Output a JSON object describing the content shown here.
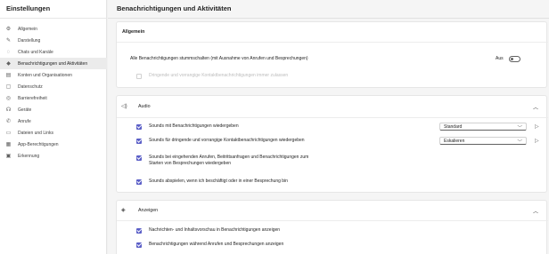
{
  "sidebar": {
    "title": "Einstellungen",
    "items": [
      {
        "label": "Allgemein",
        "icon": "gear-icon",
        "glyph": "⚙"
      },
      {
        "label": "Darstellung",
        "icon": "brush-icon",
        "glyph": "✎"
      },
      {
        "label": "Chats und Kanäle",
        "icon": "chat-icon",
        "glyph": "◌"
      },
      {
        "label": "Benachrichtigungen und Aktivitäten",
        "icon": "bell-icon",
        "glyph": "◆"
      },
      {
        "label": "Konten und Organisationen",
        "icon": "building-icon",
        "glyph": "▤"
      },
      {
        "label": "Datenschutz",
        "icon": "lock-icon",
        "glyph": "▢"
      },
      {
        "label": "Barrierefreiheit",
        "icon": "accessibility-icon",
        "glyph": "◎"
      },
      {
        "label": "Geräte",
        "icon": "headset-icon",
        "glyph": "☊"
      },
      {
        "label": "Anrufe",
        "icon": "phone-icon",
        "glyph": "✆"
      },
      {
        "label": "Dateien und Links",
        "icon": "file-icon",
        "glyph": "▭"
      },
      {
        "label": "App-Berechtigungen",
        "icon": "apps-icon",
        "glyph": "▦"
      },
      {
        "label": "Erkennung",
        "icon": "recognition-icon",
        "glyph": "▣"
      }
    ],
    "active_index": 3
  },
  "page": {
    "title": "Benachrichtigungen und Aktivitäten"
  },
  "allgemein": {
    "heading": "Allgemein",
    "mute_label": "Alle Benachrichtigungen stummschalten (mit Ausnahme von Anrufen und Besprechungen)",
    "mute_state": "Aus",
    "urgent_label": "Dringende und vorrangige Kontaktbenachrichtigungen immer zulassen"
  },
  "audio": {
    "heading": "Audio",
    "items": [
      {
        "label": "Sounds mit Benachrichtigungen wiedergeben",
        "select": "Standard"
      },
      {
        "label": "Sounds für dringende und vorrangige Kontaktbenachrichtigungen wiedergeben",
        "select": "Eskalieren"
      },
      {
        "label_line1": "Sounds bei eingehenden Anrufen, Beitrittsanfragen und Benachrichtigungen zum",
        "label_line2": "Starten von Besprechungen wiedergeben"
      },
      {
        "label": "Sounds abspielen, wenn ich beschäftigt oder in einer Besprechung bin"
      }
    ]
  },
  "anzeigen": {
    "heading": "Anzeigen",
    "items": [
      {
        "label": "Nachrichten- und Inhaltsvorschau in Benachrichtigungen anzeigen"
      },
      {
        "label": "Benachrichtigungen während Anrufen und Besprechungen anzeigen"
      }
    ]
  },
  "colors": {
    "accent": "#5b5fc7"
  }
}
